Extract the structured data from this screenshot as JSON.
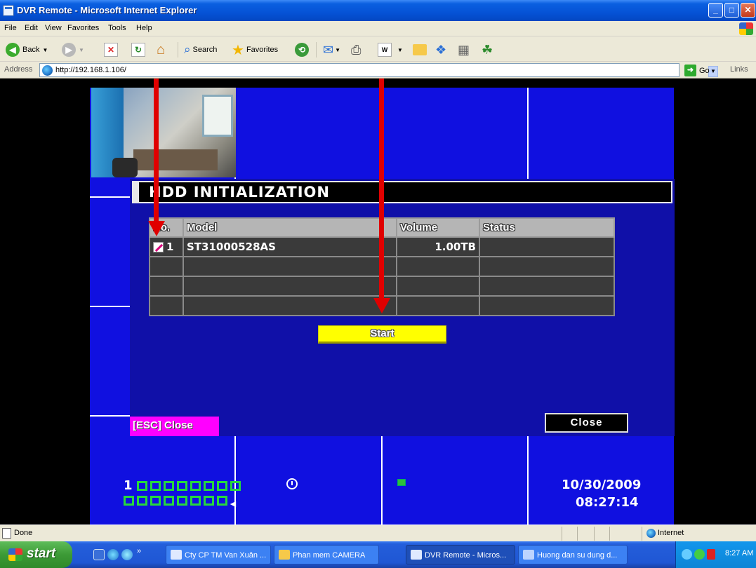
{
  "window": {
    "title": "DVR Remote - Microsoft Internet Explorer",
    "controls": {
      "minimize": "_",
      "maximize": "□",
      "close": "✕"
    }
  },
  "menu": [
    "File",
    "Edit",
    "View",
    "Favorites",
    "Tools",
    "Help"
  ],
  "toolbar": {
    "back": "Back",
    "search": "Search",
    "favorites": "Favorites"
  },
  "address": {
    "label": "Address",
    "url": "http://192.168.1.106/",
    "go": "Go",
    "links": "Links"
  },
  "dialog": {
    "title": "HDD INITIALIZATION",
    "columns": [
      "No.",
      "Model",
      "Volume",
      "Status"
    ],
    "rows": [
      {
        "no": "1",
        "model": "ST31000528AS",
        "volume": "1.00TB",
        "status": ""
      }
    ],
    "start_label": "Start",
    "esc_label": "[ESC] Close",
    "close_label": "Close"
  },
  "dvr_status": {
    "channel_start": "1",
    "date": "10/30/2009",
    "time": "08:27:14"
  },
  "statusbar": {
    "text": "Done",
    "zone": "Internet"
  },
  "taskbar": {
    "start": "start",
    "items": [
      {
        "label": "Cty CP TM Van Xuân ...",
        "active": false
      },
      {
        "label": "Phan mem CAMERA",
        "active": false
      },
      {
        "label": "DVR Remote - Micros...",
        "active": true
      },
      {
        "label": "Huong dan su dung d...",
        "active": false
      }
    ],
    "clock": "8:27 AM"
  },
  "colors": {
    "dvr_background": "#1010e0",
    "start_button": "#ffff00",
    "esc_button": "#ff00ff",
    "annotation_arrow": "#e00000"
  }
}
